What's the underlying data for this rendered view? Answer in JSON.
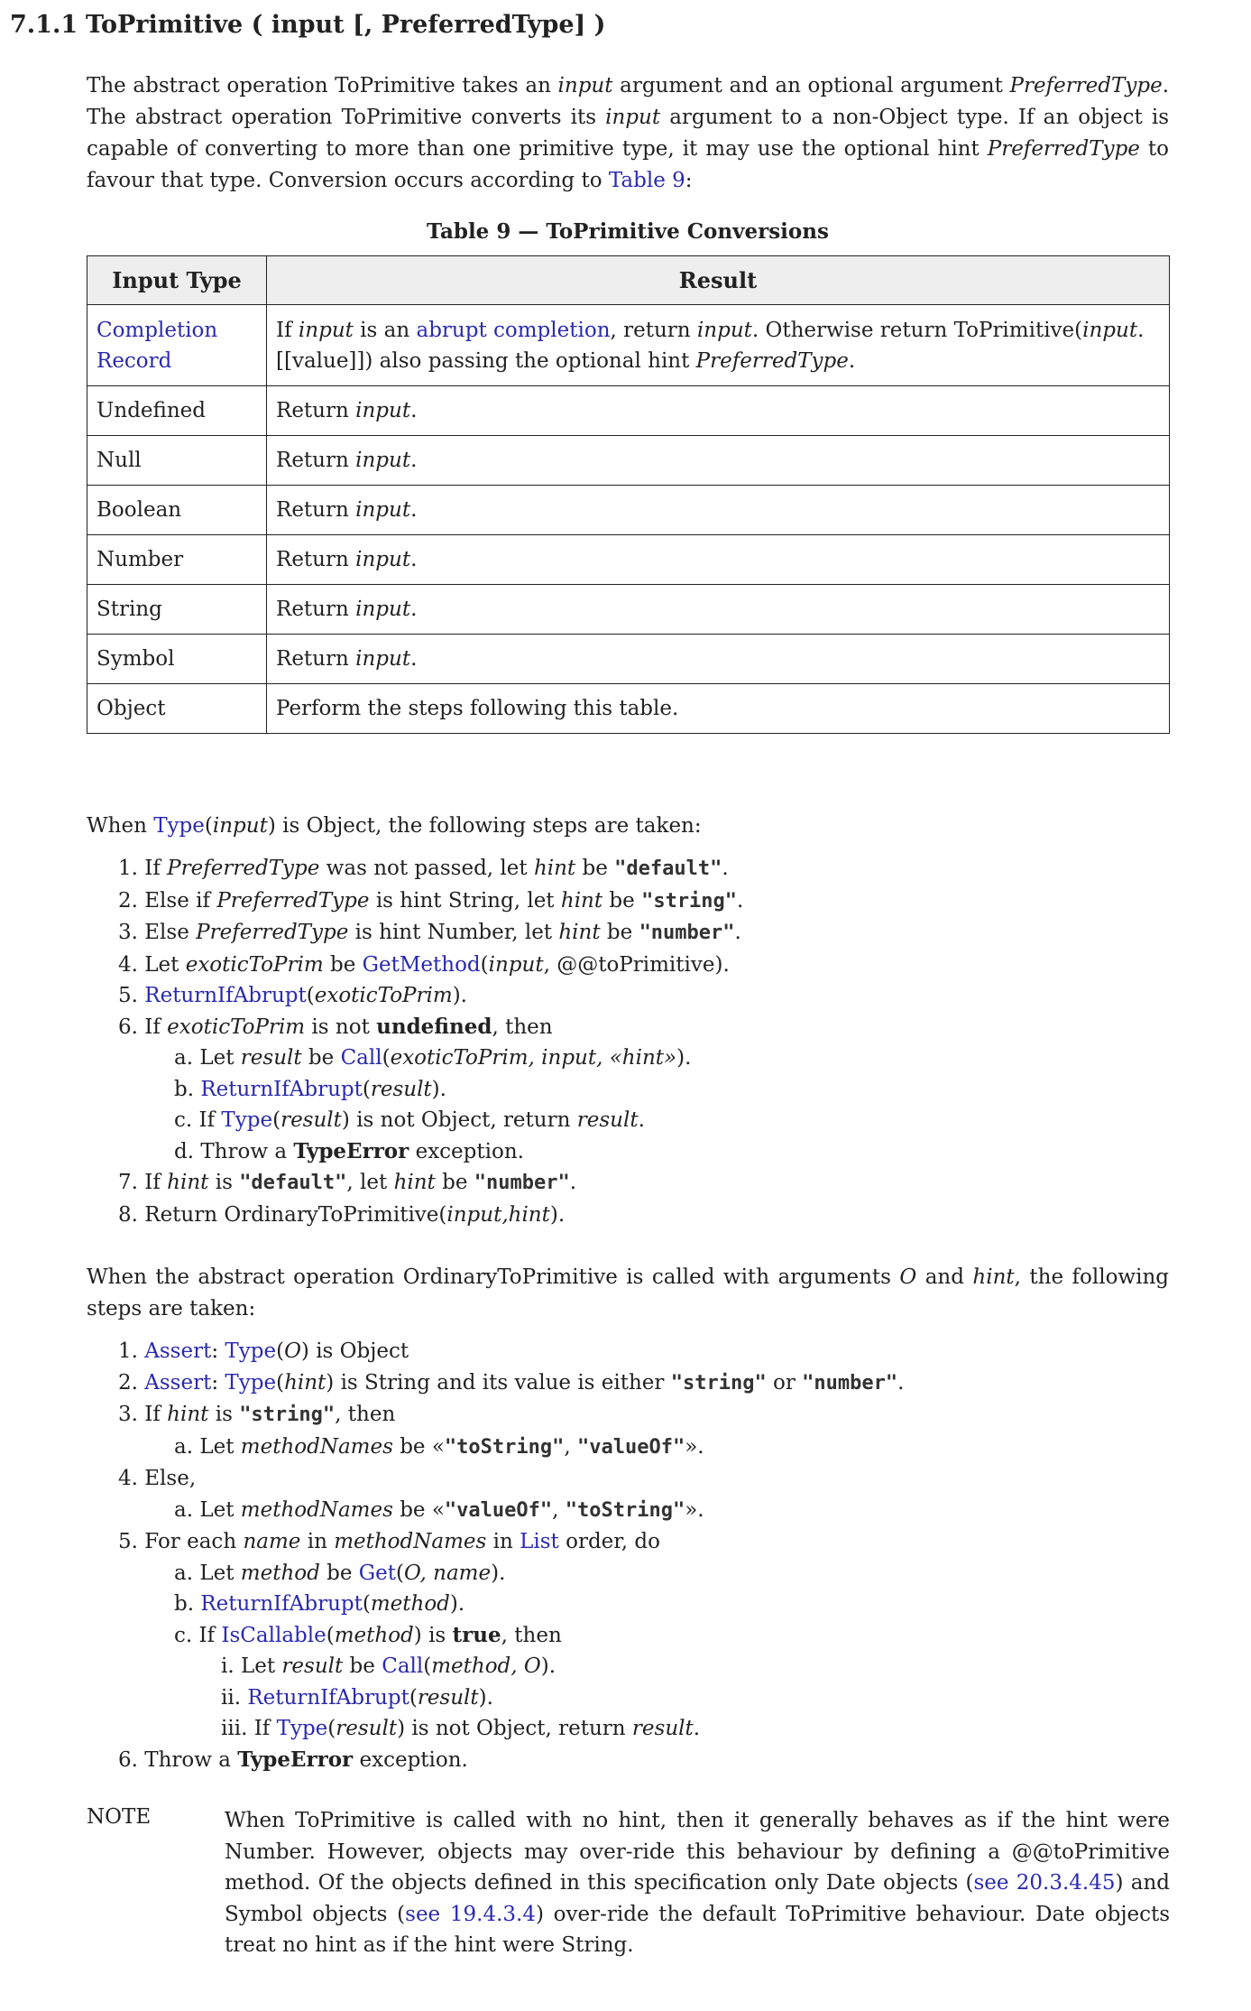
{
  "heading": {
    "number": "7.1.1",
    "title": "ToPrimitive ( input [, PreferredType] )"
  },
  "intro": {
    "t1": "The abstract operation ToPrimitive takes an ",
    "e1": "input",
    "t2": " argument and an optional argument ",
    "e2": "PreferredType",
    "t3": ". The abstract operation ToPrimitive converts its ",
    "e3": "input",
    "t4": " argument to a non-Object type. If an object is capable of converting to more than one primitive type, it may use the optional hint ",
    "e4": "PreferredType",
    "t5": " to favour that type. Conversion occurs according to ",
    "link": "Table 9",
    "t6": ":"
  },
  "table": {
    "caption": "Table 9 — ToPrimitive Conversions",
    "headers": [
      "Input Type",
      "Result"
    ],
    "completion": {
      "type_line1": "Completion",
      "type_line2": "Record",
      "r1": "If ",
      "r2": "input",
      "r3": " is an ",
      "r4": "abrupt completion",
      "r5": ", return ",
      "r6": "input",
      "r7": ". Otherwise return ToPrimitive(",
      "r8": "input",
      "r9": ".",
      "r10": "[[value]]) also passing the optional hint ",
      "r11": "PreferredType",
      "r12": "."
    },
    "return_prefix": "Return ",
    "return_italic": "input",
    "return_suffix": ".",
    "rows": [
      "Undefined",
      "Null",
      "Boolean",
      "Number",
      "String",
      "Symbol"
    ],
    "object_type": "Object",
    "object_result": "Perform the steps following this table."
  },
  "when_object": {
    "t1": "When ",
    "link": "Type",
    "t2": "(",
    "e1": "input",
    "t3": ") is Object, the following steps are taken:"
  },
  "steps1": {
    "s1": {
      "n": "1. If ",
      "e1": "PreferredType",
      "t1": " was not passed, let ",
      "e2": "hint",
      "t2": " be ",
      "c": "\"default\"",
      "t3": "."
    },
    "s2": {
      "n": "2. Else if ",
      "e1": "PreferredType",
      "t1": " is hint String, let ",
      "e2": "hint",
      "t2": " be ",
      "c": "\"string\"",
      "t3": "."
    },
    "s3": {
      "n": "3. Else ",
      "e1": "PreferredType",
      "t1": " is hint Number, let ",
      "e2": "hint",
      "t2": " be ",
      "c": "\"number\"",
      "t3": "."
    },
    "s4": {
      "n": "4. Let ",
      "e1": "exoticToPrim",
      "t1": " be ",
      "l": "GetMethod",
      "t2": "(",
      "e2": "input",
      "t3": ", @@toPrimitive)."
    },
    "s5": {
      "n": "5. ",
      "l": "ReturnIfAbrupt",
      "t1": "(",
      "e1": "exoticToPrim",
      "t2": ")."
    },
    "s6": {
      "n": "6. If ",
      "e1": "exoticToPrim",
      "t1": " is not ",
      "b": "undefined",
      "t2": ", then"
    },
    "s6a": {
      "n": "a. Let ",
      "e1": "result",
      "t1": " be ",
      "l": "Call",
      "t2": "(",
      "e2": "exoticToPrim, input, «hint»",
      "t3": ")."
    },
    "s6b": {
      "n": "b. ",
      "l": "ReturnIfAbrupt",
      "t1": "(",
      "e1": "result",
      "t2": ")."
    },
    "s6c": {
      "n": "c. If ",
      "l": "Type",
      "t1": "(",
      "e1": "result",
      "t2": ") is not Object, return ",
      "e2": "result",
      "t3": "."
    },
    "s6d": {
      "n": "d. Throw a ",
      "b": "TypeError",
      "t1": " exception."
    },
    "s7": {
      "n": "7. If ",
      "e1": "hint",
      "t1": " is ",
      "c1": "\"default\"",
      "t2": ", let ",
      "e2": "hint",
      "t3": " be ",
      "c2": "\"number\"",
      "t4": "."
    },
    "s8": {
      "n": "8. Return OrdinaryToPrimitive(",
      "e1": "input,hint",
      "t1": ")."
    }
  },
  "ordinary": {
    "t1": "When the abstract operation OrdinaryToPrimitive is called with arguments ",
    "e1": "O",
    "t2": " and ",
    "e2": "hint",
    "t3": ", the following steps are taken:"
  },
  "steps2": {
    "s1": {
      "n": "1. ",
      "l1": "Assert",
      "t1": ": ",
      "l2": "Type",
      "t2": "(",
      "e1": "O",
      "t3": ") is Object"
    },
    "s2": {
      "n": "2. ",
      "l1": "Assert",
      "t1": ": ",
      "l2": "Type",
      "t2": "(",
      "e1": "hint",
      "t3": ") is String and its value is either ",
      "c1": "\"string\"",
      "t4": " or ",
      "c2": "\"number\"",
      "t5": "."
    },
    "s3": {
      "n": "3. If ",
      "e1": "hint",
      "t1": " is ",
      "c": "\"string\"",
      "t2": ", then"
    },
    "s3a": {
      "n": "a. Let ",
      "e1": "methodNames",
      "t1": " be «",
      "c1": "\"toString\"",
      "t2": ", ",
      "c2": "\"valueOf\"",
      "t3": "»."
    },
    "s4": {
      "n": "4. Else,"
    },
    "s4a": {
      "n": "a. Let ",
      "e1": "methodNames",
      "t1": " be «",
      "c1": "\"valueOf\"",
      "t2": ", ",
      "c2": "\"toString\"",
      "t3": "»."
    },
    "s5": {
      "n": "5. For each ",
      "e1": "name",
      "t1": " in ",
      "e2": "methodNames",
      "t2": " in ",
      "l": "List",
      "t3": " order, do"
    },
    "s5a": {
      "n": "a. Let ",
      "e1": "method",
      "t1": " be ",
      "l": "Get",
      "t2": "(",
      "e2": "O, name",
      "t3": ")."
    },
    "s5b": {
      "n": "b. ",
      "l": "ReturnIfAbrupt",
      "t1": "(",
      "e1": "method",
      "t2": ")."
    },
    "s5c": {
      "n": "c. If ",
      "l": "IsCallable",
      "t1": "(",
      "e1": "method",
      "t2": ") is ",
      "b": "true",
      "t3": ", then"
    },
    "s5ci": {
      "n": "i. Let ",
      "e1": "result",
      "t1": " be ",
      "l": "Call",
      "t2": "(",
      "e2": "method, O",
      "t3": ")."
    },
    "s5cii": {
      "n": "ii. ",
      "l": "ReturnIfAbrupt",
      "t1": "(",
      "e1": "result",
      "t2": ")."
    },
    "s5ciii": {
      "n": "iii. If ",
      "l": "Type",
      "t1": "(",
      "e1": "result",
      "t2": ") is not Object, return ",
      "e2": "result",
      "t3": "."
    },
    "s6": {
      "n": "6. Throw a ",
      "b": "TypeError",
      "t1": " exception."
    }
  },
  "note": {
    "label": "NOTE",
    "t1": "When ToPrimitive is called with no hint, then it generally behaves as if the hint were Number. However, objects may over-ride this behaviour by defining a @@toPrimitive method. Of the objects defined in this specification only Date objects (",
    "l1": "see 20.3.4.45",
    "t2": ") and Symbol objects (",
    "l2": "see 19.4.3.4",
    "t3": ") over-ride the default ToPrimitive behaviour. Date objects treat no hint as if the hint were String."
  }
}
